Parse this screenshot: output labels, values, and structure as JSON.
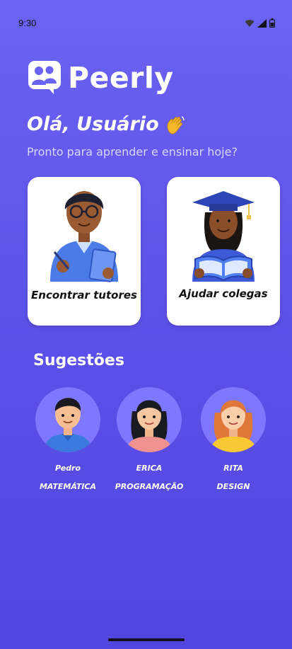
{
  "status_bar": {
    "time": "9:30"
  },
  "app": {
    "name": "Peerly"
  },
  "greeting": {
    "text": "Olá, Usuário",
    "emoji": "👋"
  },
  "subtitle": "Pronto para aprender e ensinar hoje?",
  "actions": [
    {
      "label": "Encontrar tutores"
    },
    {
      "label": "Ajudar colegas"
    }
  ],
  "suggestions": {
    "title": "Sugestões",
    "items": [
      {
        "name": "Pedro",
        "subject": "MATEMÁTICA"
      },
      {
        "name": "ERICA",
        "subject": "PROGRAMAÇÃO"
      },
      {
        "name": "RITA",
        "subject": "DESIGN"
      }
    ]
  },
  "colors": {
    "background": "#6b63f3",
    "avatar_bg": "#7e77ff",
    "card": "#ffffff"
  },
  "icons": [
    "wifi-icon",
    "signal-icon",
    "battery-icon",
    "peerly-logo-icon",
    "wave-icon"
  ]
}
